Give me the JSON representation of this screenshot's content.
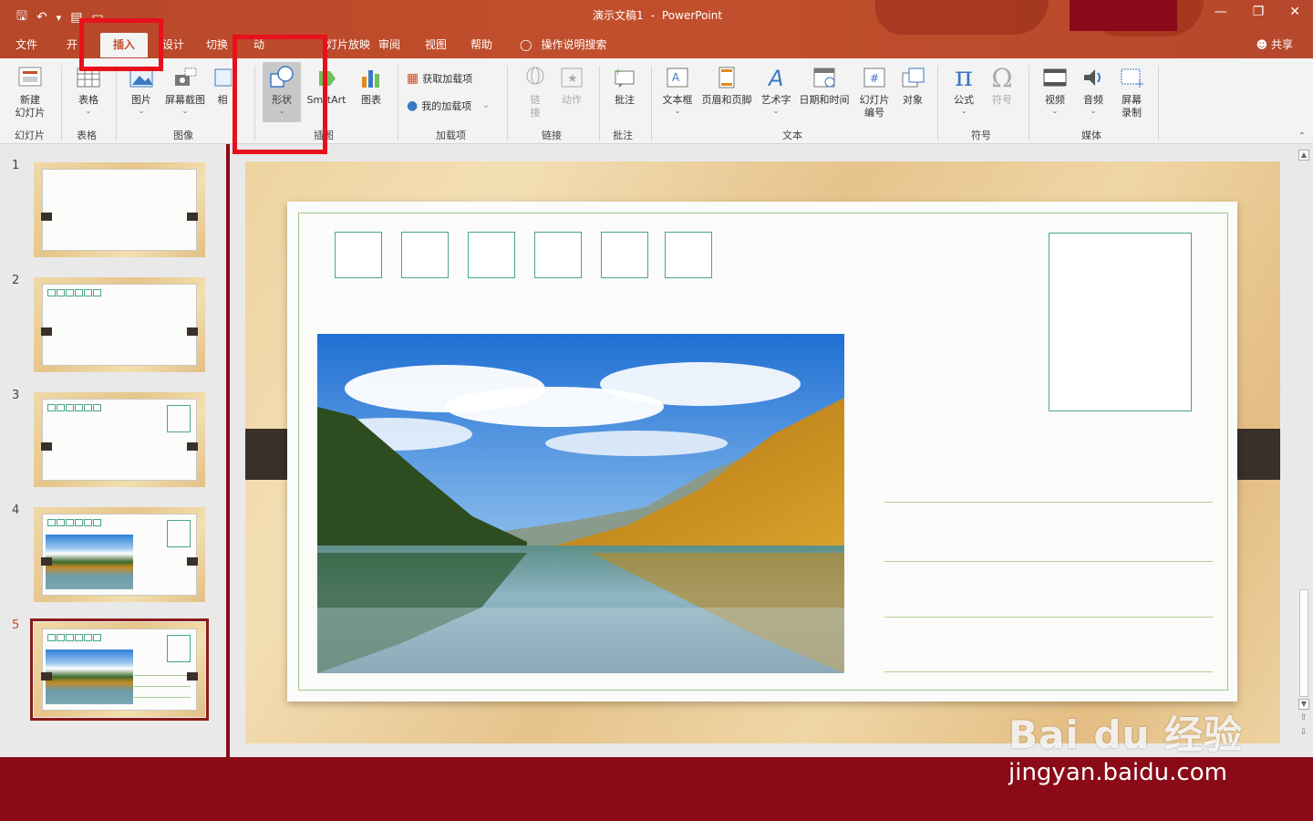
{
  "window": {
    "title": "演示文稿1",
    "app": "PowerPoint",
    "dash": "-"
  },
  "tabs": [
    {
      "label": "文件"
    },
    {
      "label": "开始"
    },
    {
      "label": "插入"
    },
    {
      "label": "设计"
    },
    {
      "label": "切换"
    },
    {
      "label": "动画"
    },
    {
      "label": "幻灯片放映"
    },
    {
      "label": "审阅"
    },
    {
      "label": "视图"
    },
    {
      "label": "帮助"
    }
  ],
  "visible_tab_text": {
    "file": "文件",
    "home_partial": "开",
    "insert": "插入",
    "design_partial": "设计",
    "transitions": "切换",
    "animations_partial": "动",
    "slideshow_partial": "灯片放映",
    "review": "审阅",
    "view": "视图",
    "help": "帮助"
  },
  "tell_me": "操作说明搜索",
  "share": "共享",
  "ribbon": {
    "new_slide": "新建\n幻灯片",
    "table": "表格",
    "pictures": "图片",
    "screenshot": "屏幕截图",
    "album_partial": "相",
    "shapes": "形状",
    "smartart_partial": "Sm",
    "smartart_partial2": "rtArt",
    "chart": "图表",
    "get_addins": "获取加载项",
    "my_addins": "我的加载项",
    "link": "链\n接",
    "action": "动作",
    "comment": "批注",
    "textbox": "文本框",
    "header_footer": "页眉和页脚",
    "wordart": "艺术字",
    "datetime": "日期和时间",
    "slide_number": "幻灯片\n编号",
    "object": "对象",
    "equation": "公式",
    "symbol": "符号",
    "video": "视频",
    "audio": "音频",
    "screen_record": "屏幕\n录制"
  },
  "groups": {
    "slides": "幻灯片",
    "tables": "表格",
    "images": "图像",
    "illustrations_partial": "插图",
    "addins": "加载项",
    "links": "链接",
    "comments": "批注",
    "text": "文本",
    "symbols": "符号",
    "media": "媒体"
  },
  "slides": [
    {
      "num": "1"
    },
    {
      "num": "2"
    },
    {
      "num": "3"
    },
    {
      "num": "4"
    },
    {
      "num": "5"
    }
  ],
  "colors": {
    "accent": "#c24f2c",
    "highlight": "#e8101c",
    "bottom_bar": "#8a0a17"
  },
  "watermark": {
    "logo": "Bai du 经验",
    "url": "jingyan.baidu.com"
  }
}
